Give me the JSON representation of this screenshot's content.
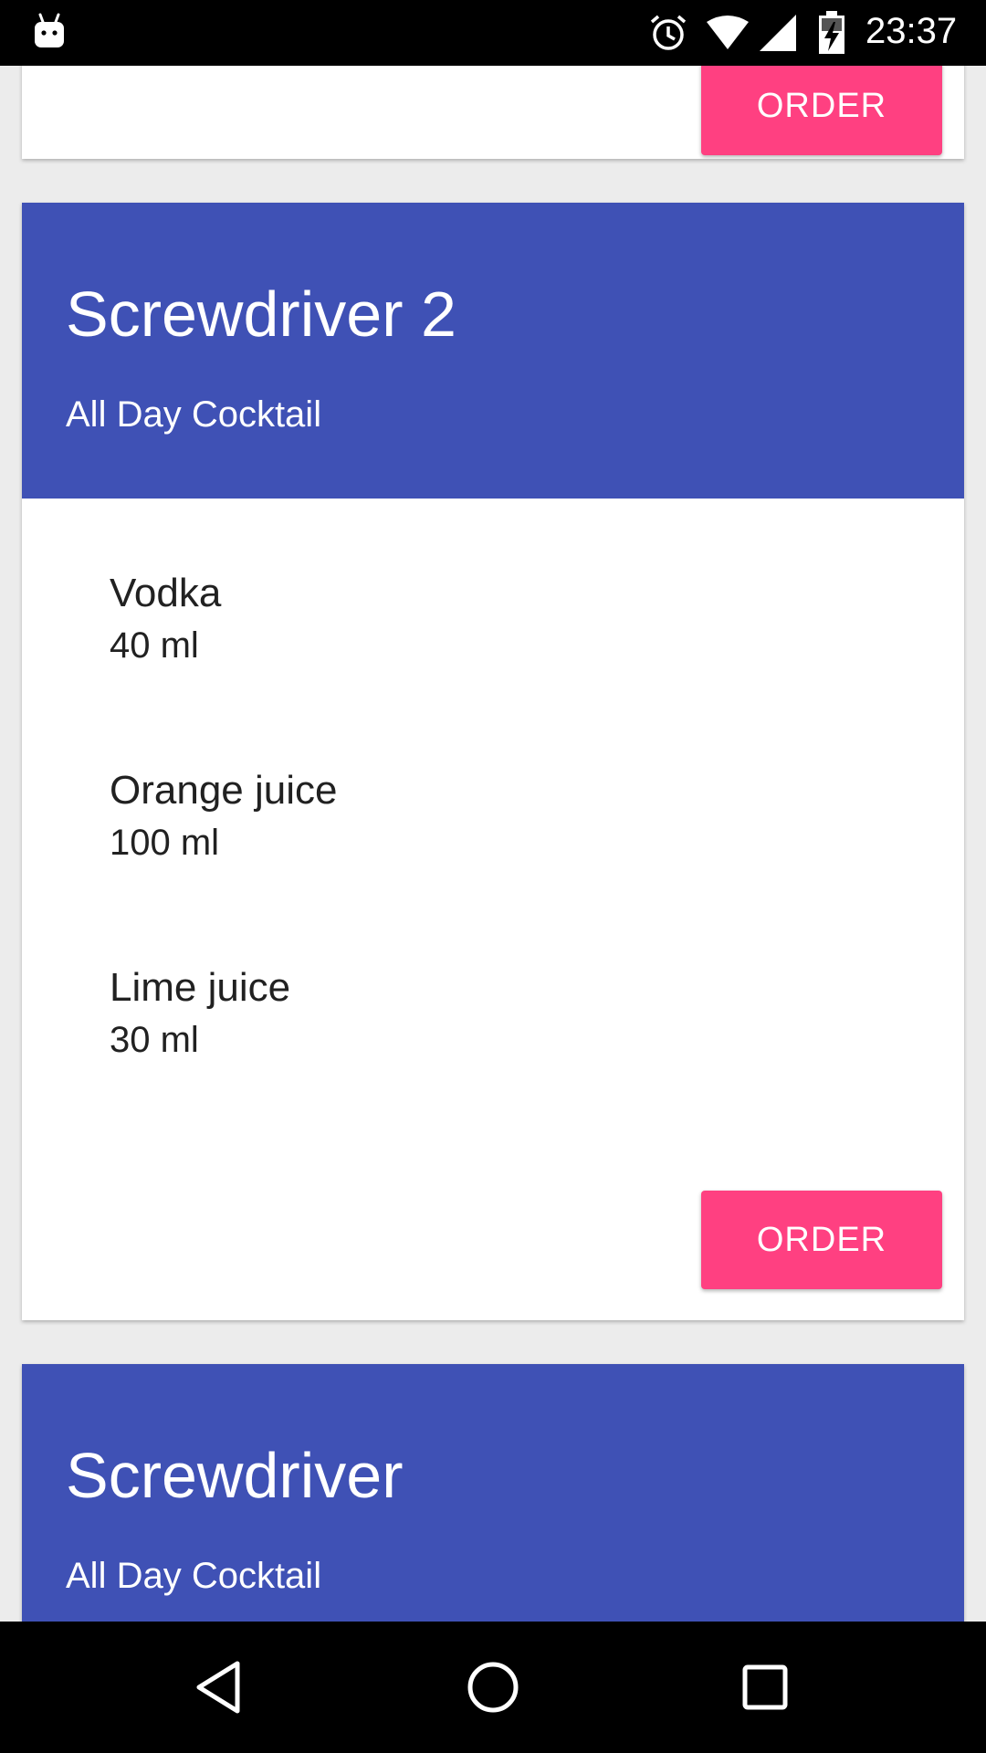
{
  "status_bar": {
    "time": "23:37",
    "icons": [
      "android-icon",
      "alarm-icon",
      "wifi-icon",
      "signal-icon",
      "battery-charging-icon"
    ]
  },
  "cards": [
    {
      "order_label": "ORDER"
    },
    {
      "title": "Screwdriver 2",
      "subtitle": "All Day Cocktail",
      "ingredients": [
        {
          "name": "Vodka",
          "amount": "40 ml"
        },
        {
          "name": "Orange juice",
          "amount": "100 ml"
        },
        {
          "name": "Lime juice",
          "amount": "30 ml"
        }
      ],
      "order_label": "ORDER"
    },
    {
      "title": "Screwdriver",
      "subtitle": "All Day Cocktail"
    }
  ],
  "colors": {
    "header": "#3f51b5",
    "accent": "#ff4081",
    "background": "#ececec"
  },
  "nav_bar": {
    "icons": [
      "back-icon",
      "home-icon",
      "recents-icon"
    ]
  }
}
